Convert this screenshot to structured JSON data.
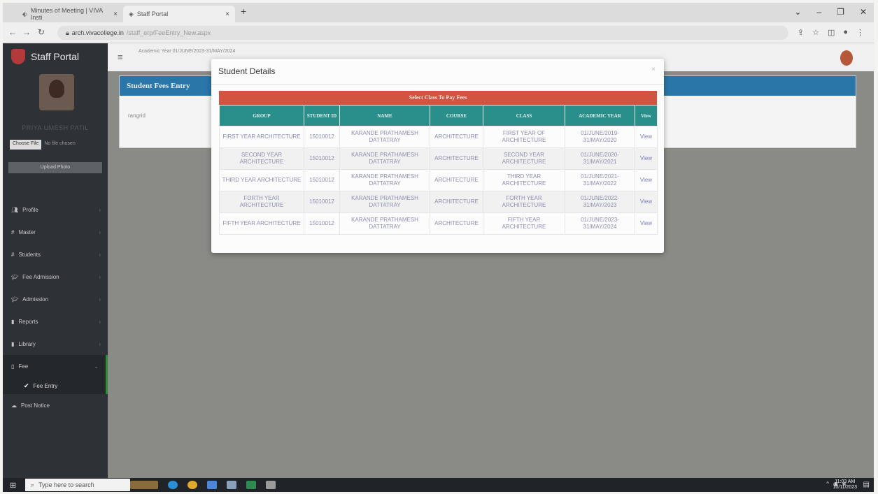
{
  "browser": {
    "tabs": [
      {
        "label": "Minutes of Meeting | VIVA Insti",
        "close": "×"
      },
      {
        "label": "Staff Portal",
        "close": "×"
      }
    ],
    "new_tab": "+",
    "url_host": "arch.vivacollege.in",
    "url_path": "/staff_erp/FeeEntry_New.aspx"
  },
  "sidebar": {
    "brand": "Staff Portal",
    "user_name": "PRIYA UMESH PATIL",
    "choose_file": "Choose File",
    "no_file": "No file chosen",
    "upload": "Upload Photo",
    "menu": [
      {
        "label": "Profile"
      },
      {
        "label": "Master"
      },
      {
        "label": "Students"
      },
      {
        "label": "Fee Admission"
      },
      {
        "label": "Admission"
      },
      {
        "label": "Reports"
      },
      {
        "label": "Library"
      },
      {
        "label": "Fee"
      }
    ],
    "submenu": {
      "label": "Fee Entry"
    },
    "last": {
      "label": "Post Notice"
    }
  },
  "topbar": {
    "selector": "Academic Year    01/JUNE/2023-31/MAY/2024"
  },
  "panel": {
    "title": "Student Fees Entry",
    "field": "rangrid"
  },
  "modal": {
    "title": "Student Details",
    "close": "×",
    "caption": "Select Class To Pay Fees",
    "headers": [
      "GROUP",
      "STUDENT ID",
      "NAME",
      "COURSE",
      "CLASS",
      "ACADEMIC YEAR",
      "View"
    ],
    "rows": [
      {
        "group": "FIRST YEAR ARCHITECTURE",
        "student_id": "15010012",
        "name": "KARANDE PRATHAMESH DATTATRAY",
        "course": "ARCHITECTURE",
        "class": "FIRST YEAR OF ARCHITECTURE",
        "year": "01/JUNE/2019-31/MAY/2020",
        "view": "View"
      },
      {
        "group": "SECOND YEAR ARCHITECTURE",
        "student_id": "15010012",
        "name": "KARANDE PRATHAMESH DATTATRAY",
        "course": "ARCHITECTURE",
        "class": "SECOND YEAR ARCHITECTURE",
        "year": "01/JUNE/2020-31/MAY/2021",
        "view": "View"
      },
      {
        "group": "THIRD YEAR ARCHITECTURE",
        "student_id": "15010012",
        "name": "KARANDE PRATHAMESH DATTATRAY",
        "course": "ARCHITECTURE",
        "class": "THIRD YEAR ARCHITECTURE",
        "year": "01/JUNE/2021-31/MAY/2022",
        "view": "View"
      },
      {
        "group": "FORTH YEAR ARCHITECTURE",
        "student_id": "15010012",
        "name": "KARANDE PRATHAMESH DATTATRAY",
        "course": "ARCHITECTURE",
        "class": "FORTH YEAR ARCHITECTURE",
        "year": "01/JUNE/2022-31/MAY/2023",
        "view": "View"
      },
      {
        "group": "FIFTH YEAR ARCHITECTURE",
        "student_id": "15010012",
        "name": "KARANDE PRATHAMESH DATTATRAY",
        "course": "ARCHITECTURE",
        "class": "FIFTH YEAR ARCHITECTURE",
        "year": "01/JUNE/2023-31/MAY/2024",
        "view": "View"
      }
    ]
  },
  "taskbar": {
    "search_placeholder": "Type here to search",
    "time": "11:03 AM",
    "date": "10/11/2023"
  },
  "colors": {
    "caption_bar": "#d2533f",
    "table_header": "#2a8f8a",
    "panel_header": "#2a76a8",
    "sidebar_bg": "#2e3236"
  }
}
